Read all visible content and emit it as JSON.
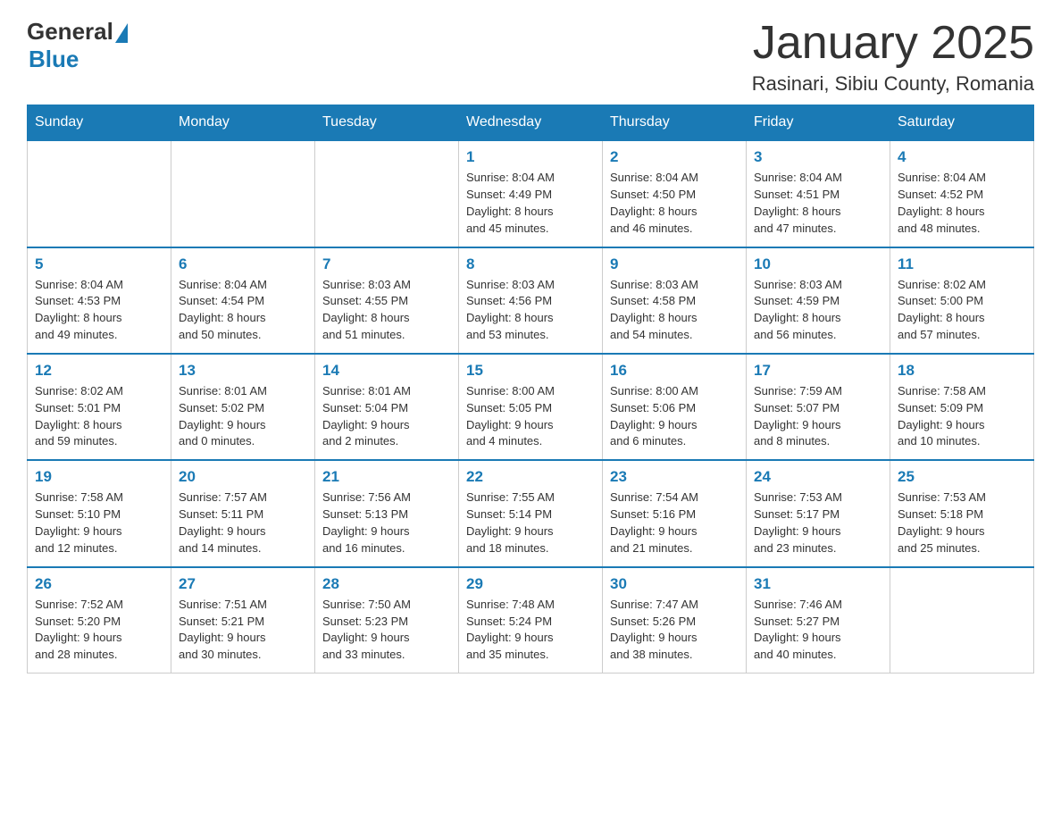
{
  "header": {
    "logo_general": "General",
    "logo_blue": "Blue",
    "month_title": "January 2025",
    "location": "Rasinari, Sibiu County, Romania"
  },
  "days_of_week": [
    "Sunday",
    "Monday",
    "Tuesday",
    "Wednesday",
    "Thursday",
    "Friday",
    "Saturday"
  ],
  "weeks": [
    [
      {
        "day": "",
        "info": ""
      },
      {
        "day": "",
        "info": ""
      },
      {
        "day": "",
        "info": ""
      },
      {
        "day": "1",
        "info": "Sunrise: 8:04 AM\nSunset: 4:49 PM\nDaylight: 8 hours\nand 45 minutes."
      },
      {
        "day": "2",
        "info": "Sunrise: 8:04 AM\nSunset: 4:50 PM\nDaylight: 8 hours\nand 46 minutes."
      },
      {
        "day": "3",
        "info": "Sunrise: 8:04 AM\nSunset: 4:51 PM\nDaylight: 8 hours\nand 47 minutes."
      },
      {
        "day": "4",
        "info": "Sunrise: 8:04 AM\nSunset: 4:52 PM\nDaylight: 8 hours\nand 48 minutes."
      }
    ],
    [
      {
        "day": "5",
        "info": "Sunrise: 8:04 AM\nSunset: 4:53 PM\nDaylight: 8 hours\nand 49 minutes."
      },
      {
        "day": "6",
        "info": "Sunrise: 8:04 AM\nSunset: 4:54 PM\nDaylight: 8 hours\nand 50 minutes."
      },
      {
        "day": "7",
        "info": "Sunrise: 8:03 AM\nSunset: 4:55 PM\nDaylight: 8 hours\nand 51 minutes."
      },
      {
        "day": "8",
        "info": "Sunrise: 8:03 AM\nSunset: 4:56 PM\nDaylight: 8 hours\nand 53 minutes."
      },
      {
        "day": "9",
        "info": "Sunrise: 8:03 AM\nSunset: 4:58 PM\nDaylight: 8 hours\nand 54 minutes."
      },
      {
        "day": "10",
        "info": "Sunrise: 8:03 AM\nSunset: 4:59 PM\nDaylight: 8 hours\nand 56 minutes."
      },
      {
        "day": "11",
        "info": "Sunrise: 8:02 AM\nSunset: 5:00 PM\nDaylight: 8 hours\nand 57 minutes."
      }
    ],
    [
      {
        "day": "12",
        "info": "Sunrise: 8:02 AM\nSunset: 5:01 PM\nDaylight: 8 hours\nand 59 minutes."
      },
      {
        "day": "13",
        "info": "Sunrise: 8:01 AM\nSunset: 5:02 PM\nDaylight: 9 hours\nand 0 minutes."
      },
      {
        "day": "14",
        "info": "Sunrise: 8:01 AM\nSunset: 5:04 PM\nDaylight: 9 hours\nand 2 minutes."
      },
      {
        "day": "15",
        "info": "Sunrise: 8:00 AM\nSunset: 5:05 PM\nDaylight: 9 hours\nand 4 minutes."
      },
      {
        "day": "16",
        "info": "Sunrise: 8:00 AM\nSunset: 5:06 PM\nDaylight: 9 hours\nand 6 minutes."
      },
      {
        "day": "17",
        "info": "Sunrise: 7:59 AM\nSunset: 5:07 PM\nDaylight: 9 hours\nand 8 minutes."
      },
      {
        "day": "18",
        "info": "Sunrise: 7:58 AM\nSunset: 5:09 PM\nDaylight: 9 hours\nand 10 minutes."
      }
    ],
    [
      {
        "day": "19",
        "info": "Sunrise: 7:58 AM\nSunset: 5:10 PM\nDaylight: 9 hours\nand 12 minutes."
      },
      {
        "day": "20",
        "info": "Sunrise: 7:57 AM\nSunset: 5:11 PM\nDaylight: 9 hours\nand 14 minutes."
      },
      {
        "day": "21",
        "info": "Sunrise: 7:56 AM\nSunset: 5:13 PM\nDaylight: 9 hours\nand 16 minutes."
      },
      {
        "day": "22",
        "info": "Sunrise: 7:55 AM\nSunset: 5:14 PM\nDaylight: 9 hours\nand 18 minutes."
      },
      {
        "day": "23",
        "info": "Sunrise: 7:54 AM\nSunset: 5:16 PM\nDaylight: 9 hours\nand 21 minutes."
      },
      {
        "day": "24",
        "info": "Sunrise: 7:53 AM\nSunset: 5:17 PM\nDaylight: 9 hours\nand 23 minutes."
      },
      {
        "day": "25",
        "info": "Sunrise: 7:53 AM\nSunset: 5:18 PM\nDaylight: 9 hours\nand 25 minutes."
      }
    ],
    [
      {
        "day": "26",
        "info": "Sunrise: 7:52 AM\nSunset: 5:20 PM\nDaylight: 9 hours\nand 28 minutes."
      },
      {
        "day": "27",
        "info": "Sunrise: 7:51 AM\nSunset: 5:21 PM\nDaylight: 9 hours\nand 30 minutes."
      },
      {
        "day": "28",
        "info": "Sunrise: 7:50 AM\nSunset: 5:23 PM\nDaylight: 9 hours\nand 33 minutes."
      },
      {
        "day": "29",
        "info": "Sunrise: 7:48 AM\nSunset: 5:24 PM\nDaylight: 9 hours\nand 35 minutes."
      },
      {
        "day": "30",
        "info": "Sunrise: 7:47 AM\nSunset: 5:26 PM\nDaylight: 9 hours\nand 38 minutes."
      },
      {
        "day": "31",
        "info": "Sunrise: 7:46 AM\nSunset: 5:27 PM\nDaylight: 9 hours\nand 40 minutes."
      },
      {
        "day": "",
        "info": ""
      }
    ]
  ]
}
